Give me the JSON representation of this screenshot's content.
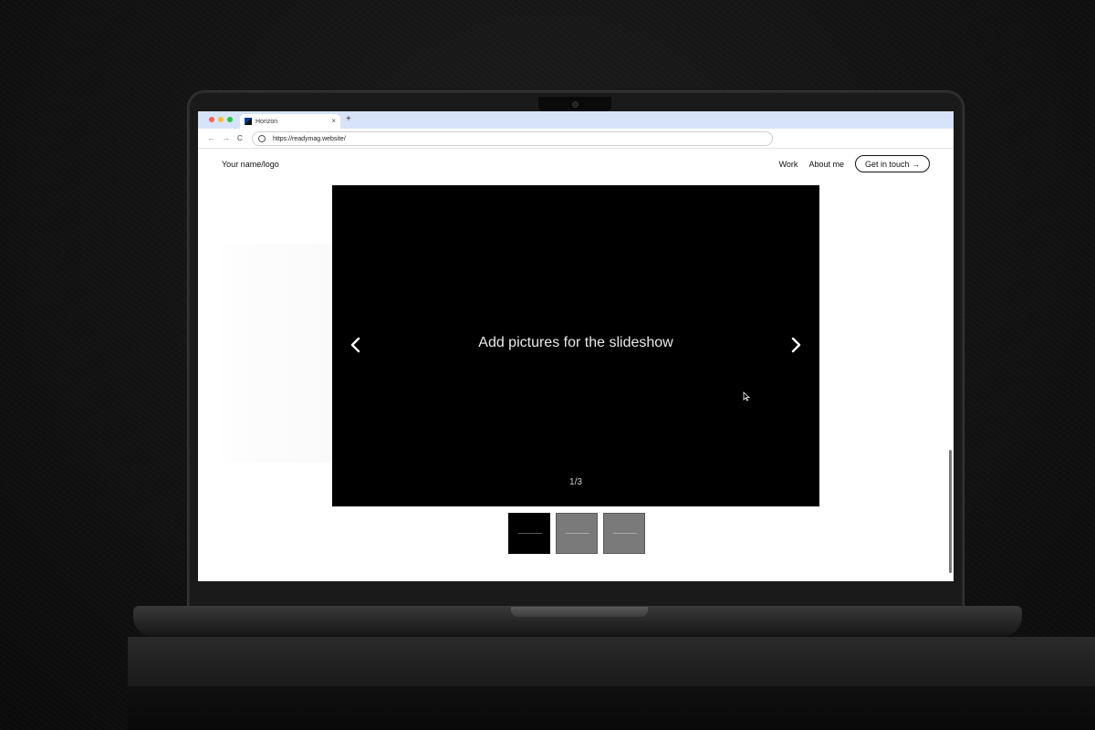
{
  "browser": {
    "tab_title": "Horizon",
    "tab_close": "×",
    "new_tab": "+",
    "url": "https://readymag.website/",
    "back_glyph": "←",
    "forward_glyph": "→",
    "reload_glyph": "C",
    "traffic_lights": {
      "close": "#ff5f57",
      "minimize": "#febc2e",
      "maximize": "#28c840"
    }
  },
  "header": {
    "logo": "Your name/logo",
    "nav": [
      {
        "label": "Work"
      },
      {
        "label": "About me"
      }
    ],
    "cta_label": "Get in touch →"
  },
  "slideshow": {
    "placeholder": "Add pictures for the slideshow",
    "counter": "1/3",
    "prev_icon": "chevron-left-icon",
    "next_icon": "chevron-right-icon"
  },
  "thumbnails": [
    {
      "color": "#000000",
      "selected": true
    },
    {
      "color": "#7a7a7a",
      "selected": false
    },
    {
      "color": "#7a7a7a",
      "selected": false
    }
  ],
  "colors": {
    "tabbar": "#d7e3f8",
    "slide_bg": "#000000",
    "page_bg": "#ffffff"
  }
}
